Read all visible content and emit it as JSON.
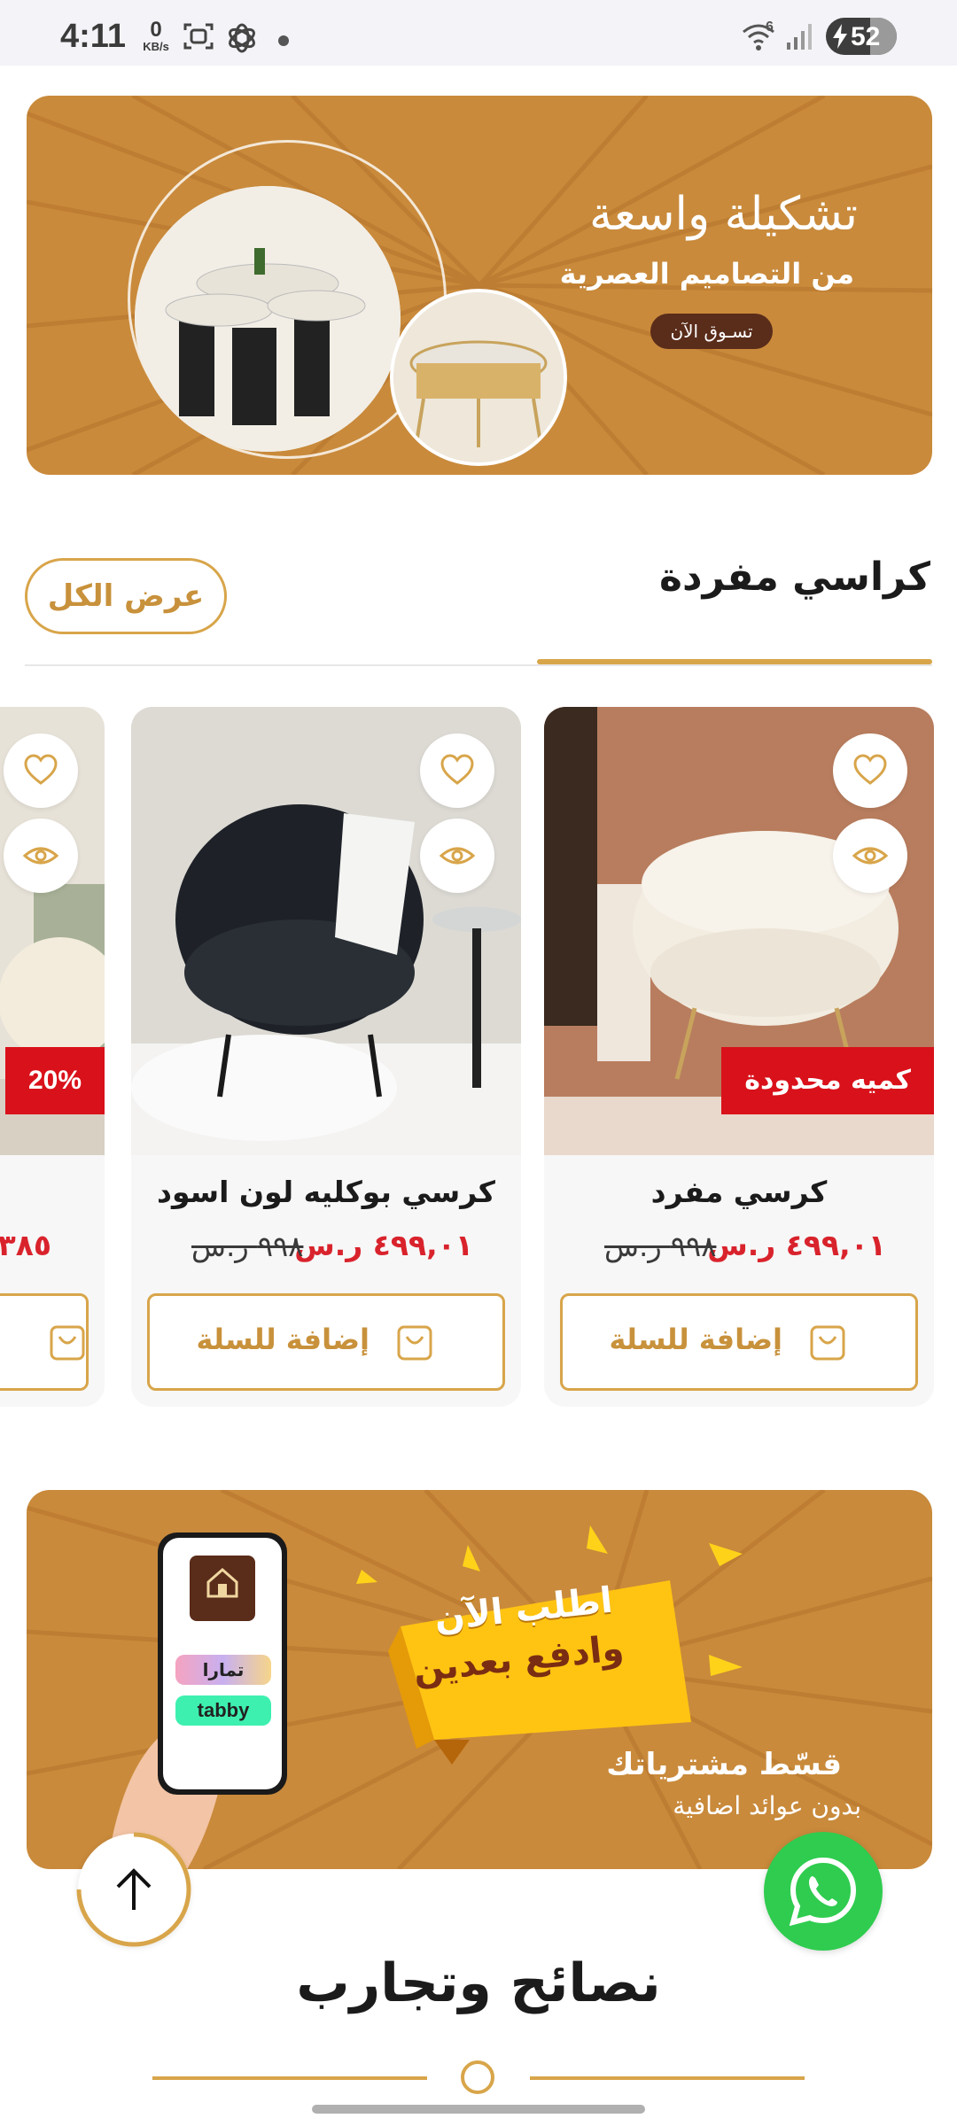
{
  "status_bar": {
    "time": "4:11",
    "net_speed_value": "0",
    "net_speed_unit": "KB/s",
    "wifi_badge": "6",
    "battery": "52",
    "icons": [
      "screenshot-icon",
      "chatgpt-icon",
      "wifi-icon",
      "signal-icon",
      "battery-charging-icon"
    ]
  },
  "hero_banner": {
    "title": "تشكيلة واسعة",
    "subtitle": "من التصاميم العصرية",
    "cta": "تسـوق الآن"
  },
  "section": {
    "title": "كراسي مفردة",
    "view_all": "عرض الكل"
  },
  "products": [
    {
      "name": "كرسي مفرد",
      "price_new": "٤٩٩,٠١ ر.س",
      "price_old": "٩٩٨ ر.س",
      "badge": "كميه محدودة",
      "add_to_cart": "إضافة للسلة"
    },
    {
      "name": "كرسي بوكليه لون اسود",
      "price_new": "٤٩٩,٠١ ر.س",
      "price_old": "٩٩٨ ر.س",
      "add_to_cart": "إضافة للسلة"
    },
    {
      "price_new": "٣٨٥",
      "badge": "20%"
    }
  ],
  "installment_banner": {
    "headline_1": "اطلب الآن",
    "headline_2": "وادفع بعدين",
    "title": "قسّط مشترياتك",
    "subtitle": "بدون عوائد اضافية",
    "provider_1": "تمارا",
    "provider_2": "tabby"
  },
  "tips": {
    "title": "نصائح وتجارب"
  },
  "colors": {
    "brand_gold": "#d8a54a",
    "banner_bg": "#c98a3b",
    "sale_red": "#d9111a",
    "price_red": "#d9232c",
    "whatsapp_green": "#2fcc4f"
  }
}
